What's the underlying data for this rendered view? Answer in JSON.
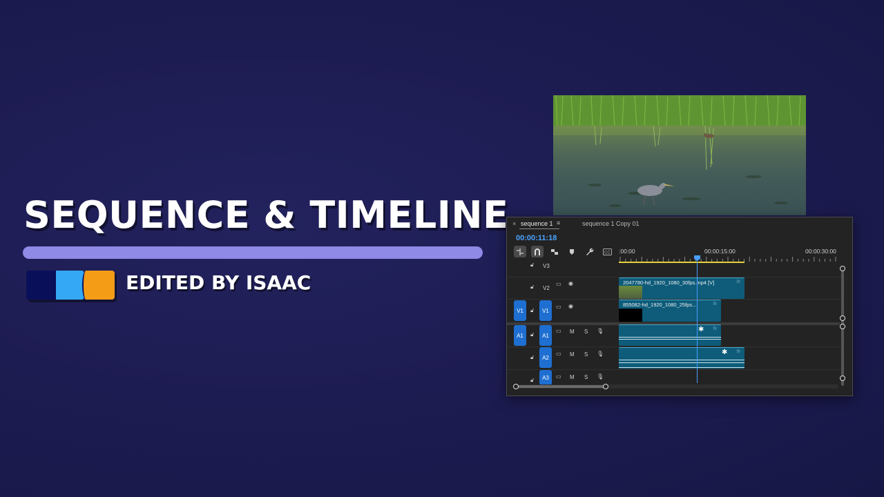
{
  "heading": {
    "title": "SEQUENCE & TIMELINE",
    "byline": "EDITED BY ISAAC"
  },
  "colors": {
    "background": "#1d1c52",
    "accent_bar": "#8f8ae6",
    "logo": [
      "#0a0f5a",
      "#35a8f5",
      "#f59c16"
    ],
    "track_target": "#1e6fd1",
    "clip": "#0e5c7a",
    "timecode": "#4aa3ff",
    "in_out_bar": "#e6d23a"
  },
  "timeline": {
    "tabs": [
      {
        "label": "sequence 1",
        "active": true
      },
      {
        "label": "sequence 1 Copy 01",
        "active": false
      }
    ],
    "close_icon": "×",
    "menu_icon": "≡",
    "timecode": "00:00:11:18",
    "tools": [
      "insert-edit-icon",
      "snap-magnet-icon",
      "linked-selection-icon",
      "marker-icon",
      "wrench-icon",
      "captions-icon"
    ],
    "ruler_labels": [
      ":00:00",
      "00:00:15:00",
      "00:00:30:00"
    ],
    "video_tracks": [
      {
        "label": "V3",
        "target": false
      },
      {
        "label": "V2",
        "target": false
      },
      {
        "label": "V1",
        "target": true,
        "source": "V1"
      }
    ],
    "audio_tracks": [
      {
        "label": "A1",
        "target": true,
        "source": "A1"
      },
      {
        "label": "A2",
        "target": true
      },
      {
        "label": "A3",
        "target": true
      }
    ],
    "audio_buttons": {
      "mute": "M",
      "solo": "S"
    },
    "clips": {
      "v2": {
        "name": "2047780-hd_1920_1080_30fps.mp4 [V]",
        "fx": "fx"
      },
      "v1": {
        "name": "855082-hd_1920_1080_25fps...",
        "fx": "fx"
      },
      "a1": {
        "fx": "fx"
      },
      "a2": {
        "fx": "fx"
      }
    }
  }
}
